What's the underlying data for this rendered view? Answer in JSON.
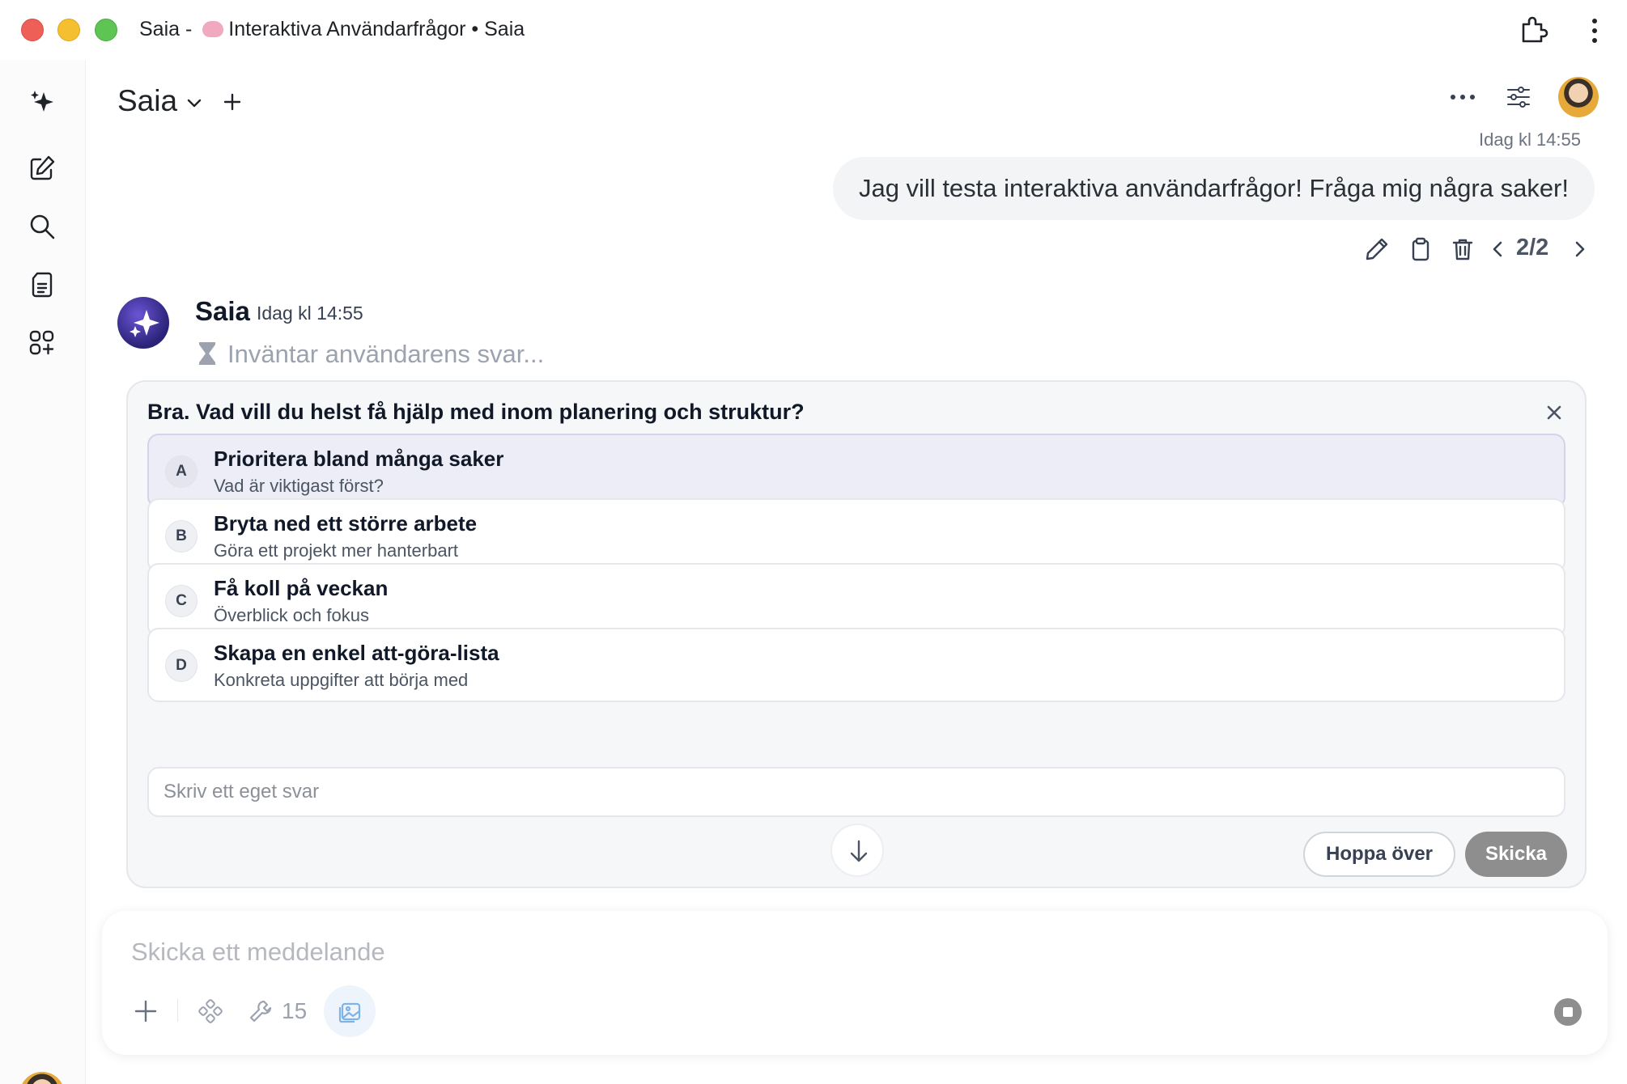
{
  "window": {
    "title_prefix": "Saia - ",
    "title_chat": "Interaktiva Användarfrågor • Saia"
  },
  "sidebar": {
    "items": [
      {
        "icon": "sparkle-icon"
      },
      {
        "icon": "new-chat-icon"
      },
      {
        "icon": "search-icon"
      },
      {
        "icon": "notes-icon"
      },
      {
        "icon": "apps-icon"
      }
    ]
  },
  "header": {
    "model": "Saia"
  },
  "user_message": {
    "time": "Idag kl 14:55",
    "text": "Jag vill testa interaktiva användarfrågor! Fråga mig några saker!",
    "pager": "2/2"
  },
  "assistant": {
    "name": "Saia",
    "time": "Idag kl 14:55",
    "status": "Inväntar användarens svar..."
  },
  "question": {
    "title": "Bra. Vad vill du helst få hjälp med inom planering och struktur?",
    "options": [
      {
        "letter": "A",
        "label": "Prioritera bland många saker",
        "sub": "Vad är viktigast först?",
        "selected": true
      },
      {
        "letter": "B",
        "label": "Bryta ned ett större arbete",
        "sub": "Göra ett projekt mer hanterbart",
        "selected": false
      },
      {
        "letter": "C",
        "label": "Få koll på veckan",
        "sub": "Överblick och fokus",
        "selected": false
      },
      {
        "letter": "D",
        "label": "Skapa en enkel att-göra-lista",
        "sub": "Konkreta uppgifter att börja med",
        "selected": false
      }
    ],
    "own_answer_placeholder": "Skriv ett eget svar",
    "skip_label": "Hoppa över",
    "send_label": "Skicka"
  },
  "composer": {
    "placeholder": "Skicka ett meddelande",
    "tool_count": "15"
  },
  "colors": {
    "selected_option_bg": "#ecedf6",
    "send_button": "#8e8e8e",
    "assistant_avatar": "#3b2f9e"
  }
}
